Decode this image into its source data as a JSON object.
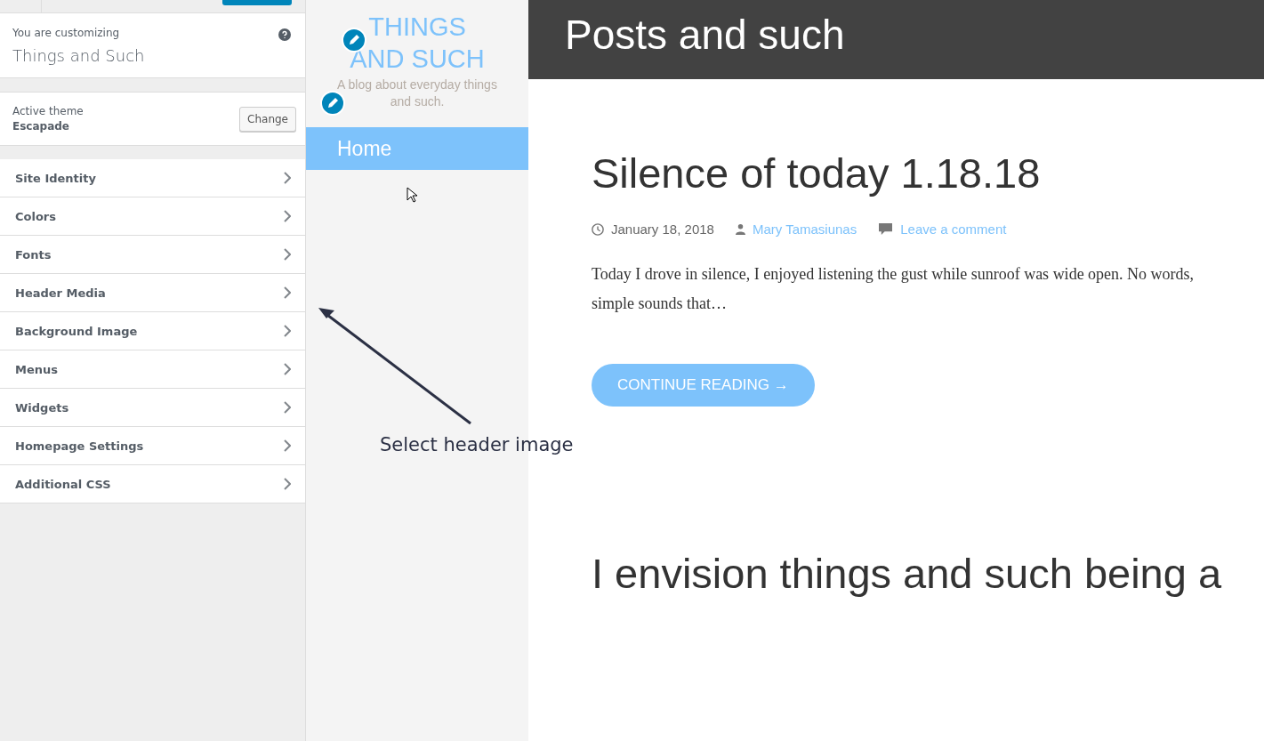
{
  "customizer": {
    "intro_label": "You are customizing",
    "site_name": "Things and Such",
    "theme_label": "Active theme",
    "theme_name": "Escapade",
    "change_button": "Change",
    "sections": [
      {
        "label": "Site Identity"
      },
      {
        "label": "Colors"
      },
      {
        "label": "Fonts"
      },
      {
        "label": "Header Media"
      },
      {
        "label": "Background Image"
      },
      {
        "label": "Menus"
      },
      {
        "label": "Widgets"
      },
      {
        "label": "Homepage Settings"
      },
      {
        "label": "Additional CSS"
      }
    ]
  },
  "site": {
    "title_lines": [
      "THINGS",
      "AND SUCH"
    ],
    "tagline": "A blog about everyday things and such.",
    "nav": [
      {
        "label": "Home",
        "selected": true
      }
    ]
  },
  "page_header": "Posts and such",
  "posts": [
    {
      "title": "Silence of today 1.18.18",
      "date": "January 18, 2018",
      "author": "Mary Tamasiunas",
      "comments": "Leave a comment",
      "excerpt": "Today I drove in silence, I enjoyed listening the gust while sunroof was wide open.  No words, simple sounds that…",
      "button": "CONTINUE READING →"
    },
    {
      "title": "I envision things and such being a"
    }
  ],
  "annotation": "Select header image"
}
